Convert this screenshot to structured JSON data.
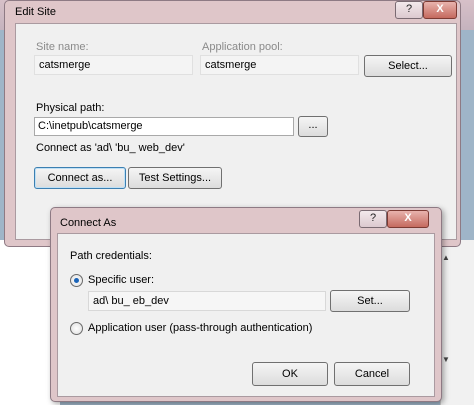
{
  "edit_site": {
    "title": "Edit Site",
    "help_label": "?",
    "close_label": "X",
    "site_name_label": "Site name:",
    "site_name_value": "catsmerge",
    "app_pool_label": "Application pool:",
    "app_pool_value": "catsmerge",
    "select_button": "Select...",
    "physical_path_label": "Physical path:",
    "physical_path_value": "C:\\inetpub\\catsmerge",
    "browse_button": "...",
    "connect_as_text": "Connect as 'ad\\  'bu_      web_dev'",
    "connect_as_button": "Connect as...",
    "test_settings_button": "Test Settings..."
  },
  "connect_as": {
    "title": "Connect As",
    "help_label": "?",
    "close_label": "X",
    "path_credentials_label": "Path credentials:",
    "specific_user_label": "Specific user:",
    "specific_user_value": "ad\\  bu_        eb_dev",
    "set_button": "Set...",
    "app_user_label": "Application user (pass-through authentication)",
    "ok_button": "OK",
    "cancel_button": "Cancel",
    "selected_option": "specific-user"
  },
  "background": {
    "scroll_up_icon": "▲",
    "scroll_down_icon": "▼"
  }
}
